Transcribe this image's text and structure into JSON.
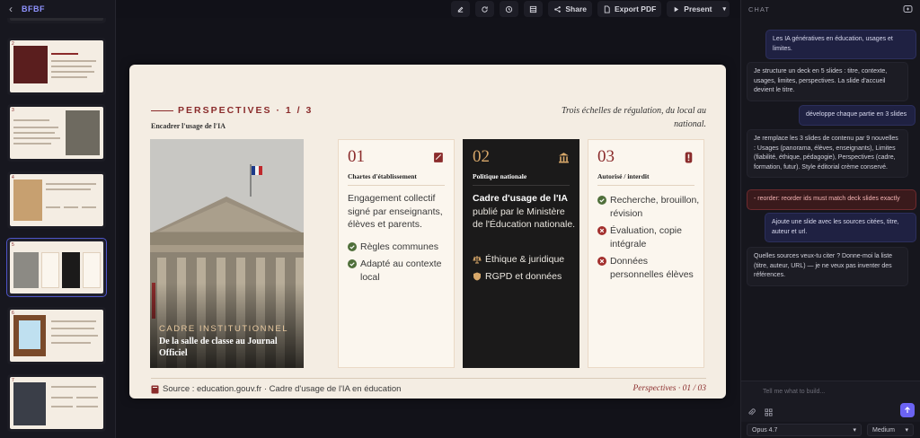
{
  "left_panel": {
    "title": "BFBF",
    "thumbnails": [
      {
        "n": "2"
      },
      {
        "n": "3"
      },
      {
        "n": "4"
      },
      {
        "n": "5"
      },
      {
        "n": "6"
      },
      {
        "n": "7"
      }
    ]
  },
  "toolbar": {
    "share": "Share",
    "export": "Export PDF",
    "present": "Present"
  },
  "slide": {
    "kicker": "PERSPECTIVES · 1 / 3",
    "subtitle": "Encadrer l'usage de l'IA",
    "quote": "Trois échelles de régulation, du local au national.",
    "photo": {
      "kicker": "CADRE INSTITUTIONNEL",
      "title": "De la salle de classe au Journal Officiel"
    },
    "cards": [
      {
        "num": "01",
        "label": "Chartes d'établissement",
        "body": "Engagement collectif signé par enseignants, élèves et parents.",
        "items": [
          "Règles communes",
          "Adapté au contexte local"
        ]
      },
      {
        "num": "02",
        "label": "Politique nationale",
        "body_strong": "Cadre d'usage de l'IA",
        "body": " publié par le Ministère de l'Éducation nationale.",
        "items": [
          "Éthique & juridique",
          "RGPD et données"
        ]
      },
      {
        "num": "03",
        "label": "Autorisé / interdit",
        "items": [
          "Recherche, brouillon, révision",
          "Évaluation, copie intégrale",
          "Données personnelles élèves"
        ]
      }
    ],
    "source": "Source : education.gouv.fr · Cadre d'usage de l'IA en éducation",
    "page": "Perspectives · 01 / 03"
  },
  "chat": {
    "label": "CHAT",
    "messages": [
      {
        "role": "user",
        "text": "Les IA génératives en éducation, usages et limites."
      },
      {
        "role": "ai",
        "text": "Je structure un deck en 5 slides : titre, contexte, usages, limites, perspectives. La slide d'accueil devient le titre."
      },
      {
        "role": "user",
        "text": "développe chaque partie en 3 slides"
      },
      {
        "role": "ai",
        "text": "Je remplace les 3 slides de contenu par 9 nouvelles : Usages (panorama, élèves, enseignants), Limites (fiabilité, éthique, pédagogie), Perspectives (cadre, formation, futur). Style éditorial crème conservé."
      },
      {
        "role": "err",
        "text": "- reorder: reorder ids must match deck slides exactly"
      },
      {
        "role": "user",
        "text": "Ajoute une slide avec les sources citées, titre, auteur et url."
      },
      {
        "role": "ai",
        "text": "Quelles sources veux-tu citer ? Donne-moi la liste (titre, auteur, URL) — je ne veux pas inventer des références."
      }
    ],
    "placeholder": "Tell me what to build...",
    "model": "Opus 4.7",
    "effort": "Medium"
  },
  "colors": {
    "accent": "#8a2b2b",
    "gold": "#d8a86a",
    "brand": "#6b63f2"
  }
}
